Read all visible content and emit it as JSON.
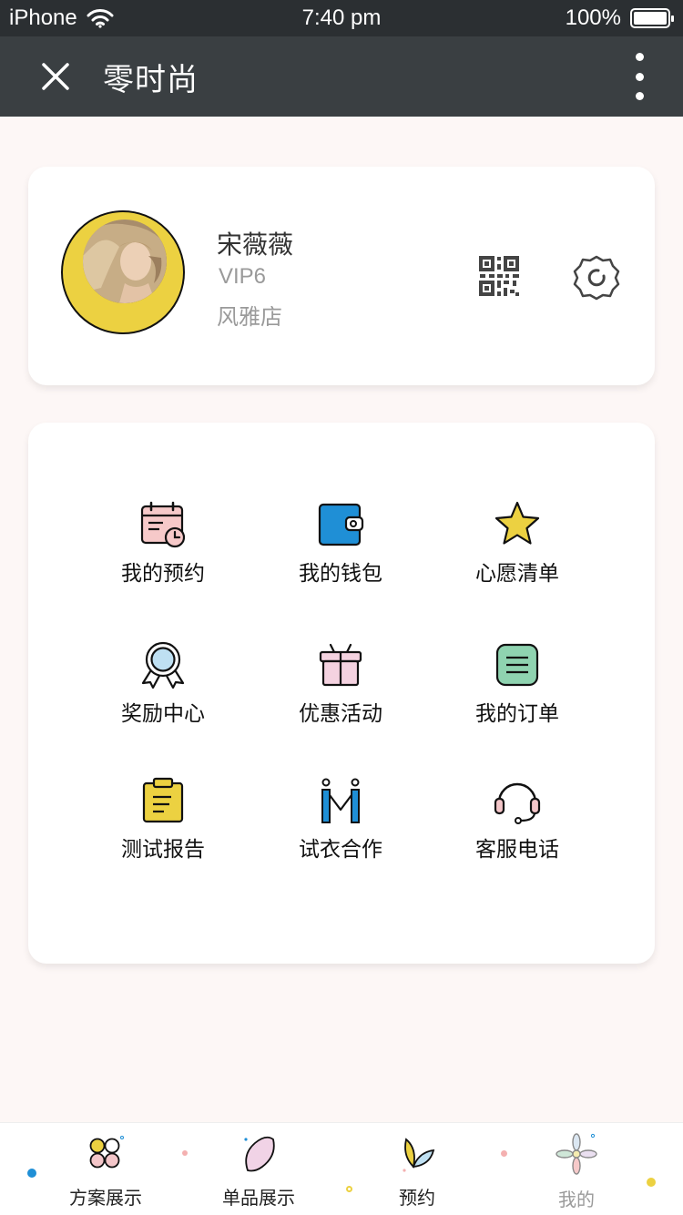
{
  "status_bar": {
    "carrier": "iPhone",
    "time": "7:40 pm",
    "battery": "100%"
  },
  "nav": {
    "title": "零时尚"
  },
  "profile": {
    "name": "宋薇薇",
    "level": "VIP6",
    "store": "风雅店"
  },
  "menu": {
    "items": [
      {
        "label": "我的预约",
        "icon": "calendar-icon"
      },
      {
        "label": "我的钱包",
        "icon": "wallet-icon"
      },
      {
        "label": "心愿清单",
        "icon": "star-icon"
      },
      {
        "label": "奖励中心",
        "icon": "medal-icon"
      },
      {
        "label": "优惠活动",
        "icon": "gift-icon"
      },
      {
        "label": "我的订单",
        "icon": "order-list-icon"
      },
      {
        "label": "测试报告",
        "icon": "clipboard-icon"
      },
      {
        "label": "试衣合作",
        "icon": "hanger-icon"
      },
      {
        "label": "客服电话",
        "icon": "headset-icon"
      }
    ]
  },
  "tabs": {
    "items": [
      {
        "label": "方案展示",
        "icon": "clover-icon"
      },
      {
        "label": "单品展示",
        "icon": "petal-icon"
      },
      {
        "label": "预约",
        "icon": "leaves-icon"
      },
      {
        "label": "我的",
        "icon": "flower-icon",
        "active": true
      }
    ]
  },
  "colors": {
    "status_bar_bg": "#2b2f32",
    "nav_bg": "#3a3f42",
    "page_bg": "#fdf7f6",
    "accent_yellow": "#ecd141",
    "accent_blue": "#1f8fd6",
    "accent_pink": "#f4c6c9",
    "accent_green": "#8fd3b0"
  }
}
